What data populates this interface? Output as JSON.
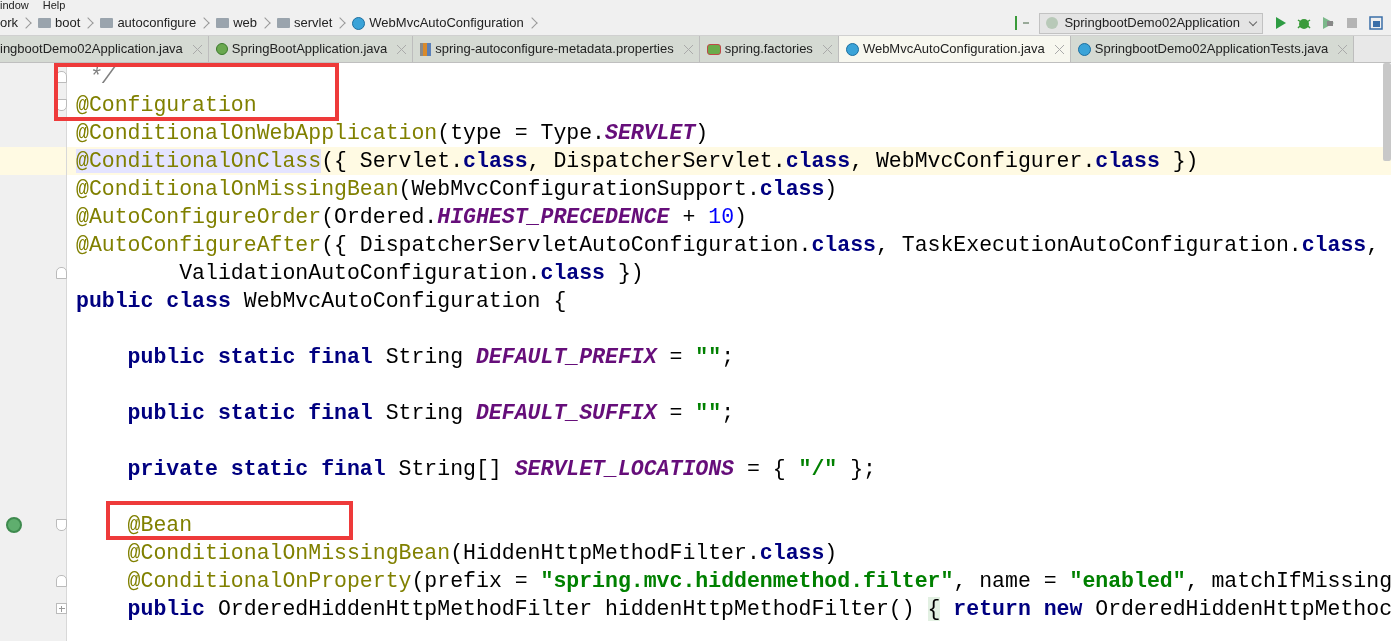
{
  "menu": [
    "indow",
    "Help"
  ],
  "breadcrumbs": [
    {
      "label": "ork",
      "kind": "text"
    },
    {
      "label": "boot",
      "kind": "folder"
    },
    {
      "label": "autoconfigure",
      "kind": "folder"
    },
    {
      "label": "web",
      "kind": "folder"
    },
    {
      "label": "servlet",
      "kind": "folder"
    },
    {
      "label": "WebMvcAutoConfiguration",
      "kind": "class"
    }
  ],
  "run_config": {
    "label": "SpringbootDemo02Application"
  },
  "tabs": [
    {
      "label": "ingbootDemo02Application.java",
      "kind": "plain",
      "selected": false
    },
    {
      "label": "SpringBootApplication.java",
      "kind": "annotation",
      "selected": false
    },
    {
      "label": "spring-autoconfigure-metadata.properties",
      "kind": "properties",
      "selected": false
    },
    {
      "label": "spring.factories",
      "kind": "factories",
      "selected": false
    },
    {
      "label": "WebMvcAutoConfiguration.java",
      "kind": "class",
      "selected": true
    },
    {
      "label": "SpringbootDemo02ApplicationTests.java",
      "kind": "class",
      "selected": false
    }
  ],
  "code_lines": [
    {
      "fold_marker": {
        "kind": "close"
      },
      "boxed": true,
      "tokens": [
        {
          "t": " */",
          "kind": "comment"
        }
      ]
    },
    {
      "fold_marker": {
        "kind": "open"
      },
      "boxed": true,
      "tokens": [
        {
          "t": "@Configuration",
          "kind": "ann"
        }
      ]
    },
    {
      "tokens": [
        {
          "t": "@ConditionalOnWebApplication",
          "kind": "ann"
        },
        {
          "t": "(type = Type.",
          "kind": "plain"
        },
        {
          "t": "SERVLET",
          "kind": "const"
        },
        {
          "t": ")",
          "kind": "plain"
        }
      ]
    },
    {
      "current": true,
      "tokens": [
        {
          "t": "@ConditionalOnClass",
          "kind": "ann_hl"
        },
        {
          "t": "({ Servlet.",
          "kind": "plain"
        },
        {
          "t": "class",
          "kind": "kw"
        },
        {
          "t": ", DispatcherServlet.",
          "kind": "plain"
        },
        {
          "t": "class",
          "kind": "kw"
        },
        {
          "t": ", WebMvcConfigurer.",
          "kind": "plain"
        },
        {
          "t": "class",
          "kind": "kw"
        },
        {
          "t": " })",
          "kind": "plain"
        }
      ]
    },
    {
      "tokens": [
        {
          "t": "@ConditionalOnMissingBean",
          "kind": "ann"
        },
        {
          "t": "(WebMvcConfigurationSupport.",
          "kind": "plain"
        },
        {
          "t": "class",
          "kind": "kw"
        },
        {
          "t": ")",
          "kind": "plain"
        }
      ]
    },
    {
      "tokens": [
        {
          "t": "@AutoConfigureOrder",
          "kind": "ann"
        },
        {
          "t": "(Ordered.",
          "kind": "plain"
        },
        {
          "t": "HIGHEST_PRECEDENCE",
          "kind": "const"
        },
        {
          "t": " + ",
          "kind": "plain"
        },
        {
          "t": "10",
          "kind": "num"
        },
        {
          "t": ")",
          "kind": "plain"
        }
      ]
    },
    {
      "tokens": [
        {
          "t": "@AutoConfigureAfter",
          "kind": "ann"
        },
        {
          "t": "({ DispatcherServletAutoConfiguration.",
          "kind": "plain"
        },
        {
          "t": "class",
          "kind": "kw"
        },
        {
          "t": ", TaskExecutionAutoConfiguration.",
          "kind": "plain"
        },
        {
          "t": "class",
          "kind": "kw"
        },
        {
          "t": ",",
          "kind": "plain"
        }
      ]
    },
    {
      "fold_marker": {
        "kind": "close"
      },
      "tokens": [
        {
          "t": "        ValidationAutoConfiguration.",
          "kind": "plain"
        },
        {
          "t": "class",
          "kind": "kw"
        },
        {
          "t": " })",
          "kind": "plain"
        }
      ]
    },
    {
      "tokens": [
        {
          "t": "public class",
          "kind": "kw"
        },
        {
          "t": " WebMvcAutoConfiguration {",
          "kind": "plain"
        }
      ]
    },
    {
      "blank": true
    },
    {
      "tokens": [
        {
          "t": "    public static final",
          "kind": "kw"
        },
        {
          "t": " String ",
          "kind": "plain"
        },
        {
          "t": "DEFAULT_PREFIX",
          "kind": "const"
        },
        {
          "t": " = ",
          "kind": "plain"
        },
        {
          "t": "\"\"",
          "kind": "str"
        },
        {
          "t": ";",
          "kind": "plain"
        }
      ]
    },
    {
      "blank": true
    },
    {
      "tokens": [
        {
          "t": "    public static final",
          "kind": "kw"
        },
        {
          "t": " String ",
          "kind": "plain"
        },
        {
          "t": "DEFAULT_SUFFIX",
          "kind": "const"
        },
        {
          "t": " = ",
          "kind": "plain"
        },
        {
          "t": "\"\"",
          "kind": "str"
        },
        {
          "t": ";",
          "kind": "plain"
        }
      ]
    },
    {
      "blank": true
    },
    {
      "tokens": [
        {
          "t": "    private static final",
          "kind": "kw"
        },
        {
          "t": " String[] ",
          "kind": "plain"
        },
        {
          "t": "SERVLET_LOCATIONS",
          "kind": "const"
        },
        {
          "t": " = { ",
          "kind": "plain"
        },
        {
          "t": "\"/\"",
          "kind": "str"
        },
        {
          "t": " };",
          "kind": "plain"
        }
      ]
    },
    {
      "blank": true
    },
    {
      "fold_marker": {
        "kind": "open"
      },
      "boxed": true,
      "gutter_icon": {
        "kind": "bean"
      },
      "tokens": [
        {
          "t": "    @Bean",
          "kind": "ann"
        }
      ]
    },
    {
      "tokens": [
        {
          "t": "    @ConditionalOnMissingBean",
          "kind": "ann"
        },
        {
          "t": "(HiddenHttpMethodFilter.",
          "kind": "plain"
        },
        {
          "t": "class",
          "kind": "kw"
        },
        {
          "t": ")",
          "kind": "plain"
        }
      ]
    },
    {
      "fold_marker": {
        "kind": "close"
      },
      "tokens": [
        {
          "t": "    @ConditionalOnProperty",
          "kind": "ann"
        },
        {
          "t": "(prefix = ",
          "kind": "plain"
        },
        {
          "t": "\"spring.mvc.hiddenmethod.filter\"",
          "kind": "str"
        },
        {
          "t": ", name = ",
          "kind": "plain"
        },
        {
          "t": "\"enabled\"",
          "kind": "str"
        },
        {
          "t": ", matchIfMissing",
          "kind": "plain"
        }
      ]
    },
    {
      "fold_marker": {
        "kind": "collapsed"
      },
      "tokens": [
        {
          "t": "    public",
          "kind": "kw"
        },
        {
          "t": " OrderedHiddenHttpMethodFilter hiddenHttpMethodFilter() ",
          "kind": "plain"
        },
        {
          "t": "{",
          "kind": "brace"
        },
        {
          "t": " return new",
          "kind": "kw"
        },
        {
          "t": " OrderedHiddenHttpMethoc",
          "kind": "plain"
        }
      ]
    }
  ]
}
